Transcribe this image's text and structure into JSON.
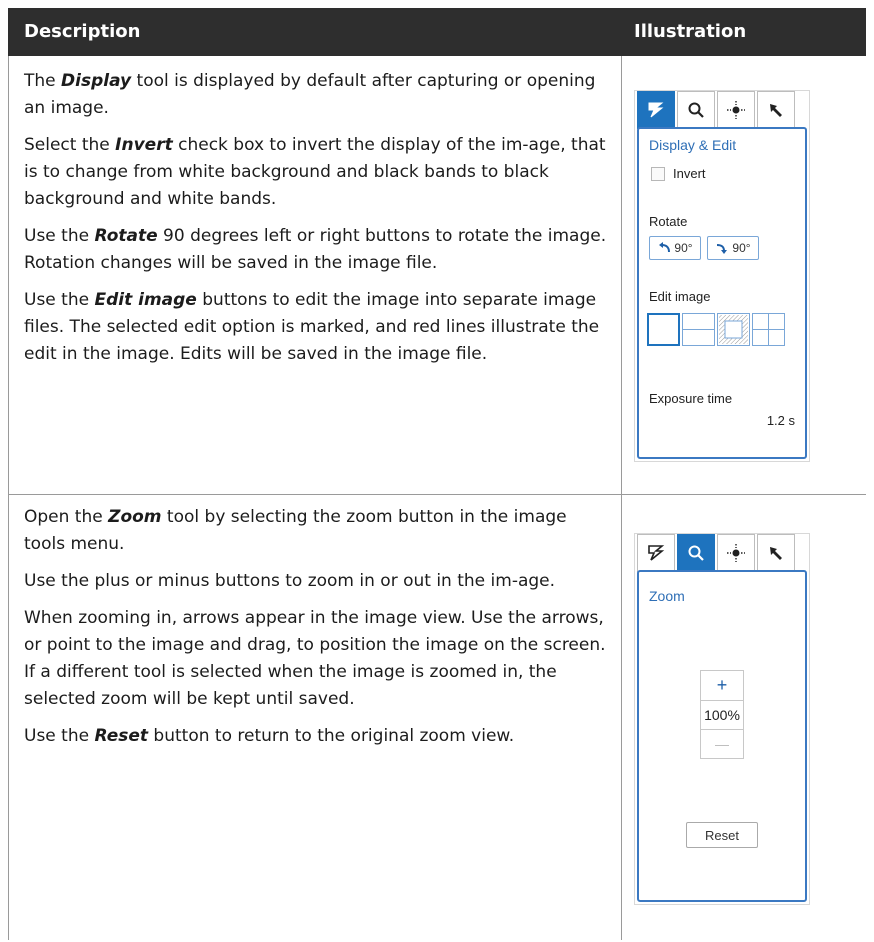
{
  "table": {
    "header": {
      "description": "Description",
      "illustration": "Illustration"
    },
    "rows": [
      {
        "paragraphs": [
          {
            "pre": "The ",
            "em": "Display",
            "post": " tool is displayed by default after capturing or opening an image."
          },
          {
            "pre": "Select the ",
            "em": "Invert",
            "post": " check box to invert the display of the im-age, that is to change from white background and black bands to black background and white bands."
          },
          {
            "pre": "Use the ",
            "em": "Rotate",
            "post": " 90 degrees left or right buttons to rotate the image. Rotation changes will be saved in the image file."
          },
          {
            "pre": "Use the ",
            "em": "Edit image",
            "post": " buttons to edit the image into separate image files. The selected edit option is marked, and red lines illustrate the edit in the image. Edits will be saved in the image file."
          }
        ]
      },
      {
        "paragraphs": [
          {
            "pre": "Open the ",
            "em": "Zoom",
            "post": " tool by selecting the zoom button in the image tools menu."
          },
          {
            "pre": "Use the plus or minus buttons to zoom in or out in the im-age.",
            "em": "",
            "post": ""
          },
          {
            "pre": "When zooming in, arrows appear in the image view. Use the arrows, or point to the image and drag, to position the image on the screen. If a different tool is selected when the image is zoomed in, the selected zoom will be kept until saved.",
            "em": "",
            "post": ""
          },
          {
            "pre": "Use the ",
            "em": "Reset",
            "post": " button to return to the original zoom view."
          }
        ]
      }
    ]
  },
  "display_panel": {
    "title": "Display & Edit",
    "invert_label": "Invert",
    "invert_checked": false,
    "rotate_label": "Rotate",
    "rotate_left": "90°",
    "rotate_right": "90°",
    "edit_label": "Edit image",
    "exposure_label": "Exposure time",
    "exposure_value": "1.2 s",
    "active_tab": "display"
  },
  "zoom_panel": {
    "title": "Zoom",
    "plus": "+",
    "level": "100%",
    "minus": "—",
    "reset": "Reset",
    "active_tab": "zoom"
  },
  "icons": [
    "display-tool-icon",
    "zoom-tool-icon",
    "brightness-tool-icon",
    "pointer-tool-icon"
  ],
  "colors": {
    "header_bg": "#2e2e2e",
    "accent": "#1e73be",
    "panel_border": "#3b79c2"
  }
}
